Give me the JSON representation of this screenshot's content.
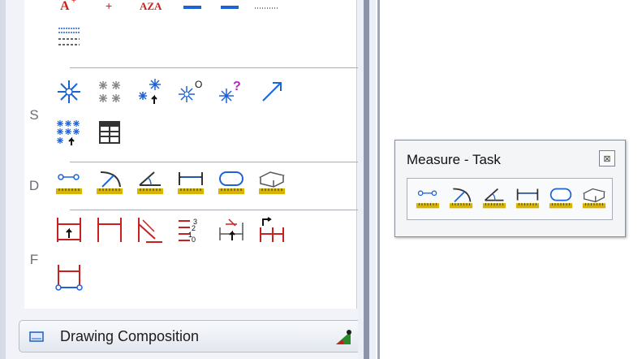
{
  "panel": {
    "row_labels": [
      "S",
      "D",
      "F"
    ]
  },
  "drawing_composition": {
    "label": "Drawing Composition"
  },
  "measure_dialog": {
    "title": "Measure - Task",
    "close_glyph": "⊠",
    "tools": [
      {
        "icon": "measure-distance-icon"
      },
      {
        "icon": "measure-radius-icon"
      },
      {
        "icon": "measure-angle-icon"
      },
      {
        "icon": "measure-length-icon"
      },
      {
        "icon": "measure-area-icon"
      },
      {
        "icon": "measure-volume-icon"
      }
    ]
  },
  "colors": {
    "icon_blue": "#1e63d6",
    "icon_red": "#c82020",
    "ruler_yellow": "#d8b400"
  }
}
